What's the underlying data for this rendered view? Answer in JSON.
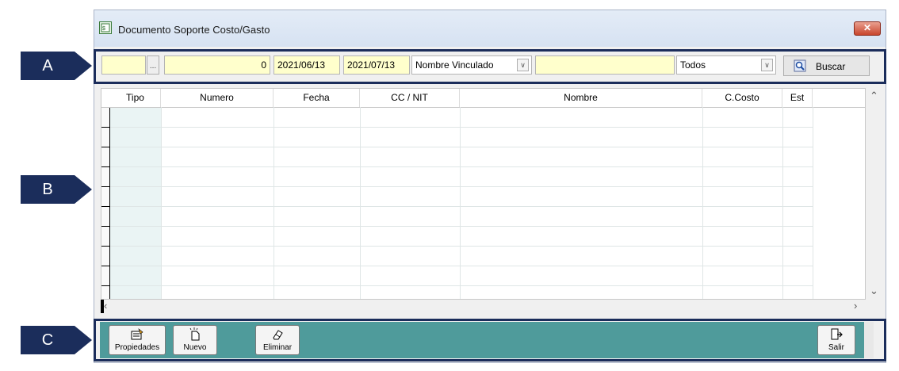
{
  "window": {
    "title": "Documento Soporte Costo/Gasto",
    "close_label": "✕"
  },
  "callouts": {
    "a": "A",
    "b": "B",
    "c": "C"
  },
  "filters": {
    "code_value": "",
    "ellipsis_label": "...",
    "number_value": "0",
    "date_from": "2021/06/13",
    "date_to": "2021/07/13",
    "field_select": "Nombre Vinculado",
    "search_text": "",
    "status_select": "Todos",
    "search_button": "Buscar"
  },
  "grid": {
    "columns": [
      "Tipo",
      "Numero",
      "Fecha",
      "CC / NIT",
      "Nombre",
      "C.Costo",
      "Est"
    ]
  },
  "footer": {
    "properties_label": "Propiedades",
    "new_label": "Nuevo",
    "delete_label": "Eliminar",
    "exit_label": "Salir"
  },
  "colors": {
    "callout": "#1b2d5b",
    "input_bg": "#ffffcc",
    "footer_bg": "#4f9b9b",
    "grid_first_col": "#eaf4f4"
  },
  "icons": {
    "title": "document-icon",
    "search": "search-icon",
    "properties": "properties-icon",
    "new": "new-document-icon",
    "delete": "eraser-icon",
    "exit": "exit-door-icon"
  }
}
